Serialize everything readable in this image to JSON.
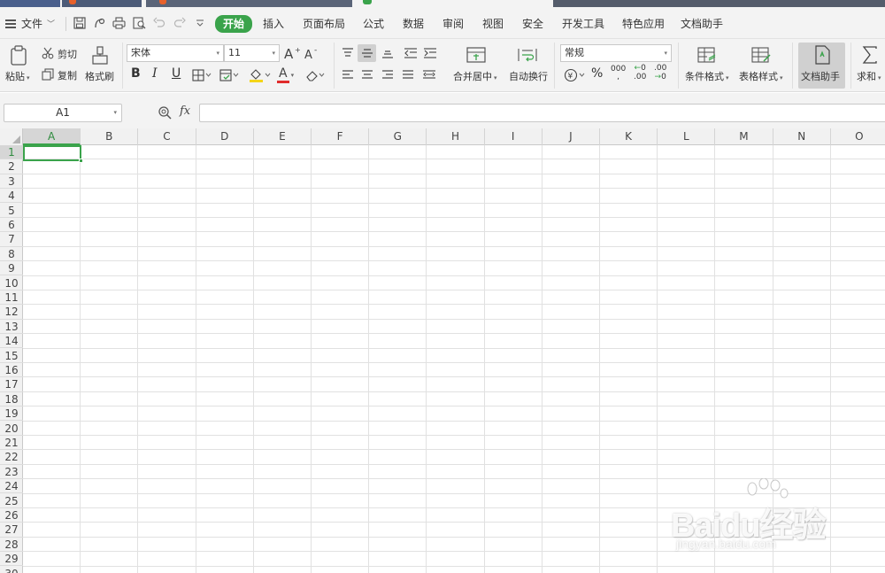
{
  "colors": {
    "accent": "#3aa34b",
    "ribbon_bg": "#f3f3f3",
    "grid_line": "#e1e1e1",
    "header_bg": "#f1f1f1"
  },
  "menu": {
    "file_label": "文件",
    "tabs": [
      {
        "label": "开始",
        "active": true
      },
      {
        "label": "插入"
      },
      {
        "label": "页面布局"
      },
      {
        "label": "公式"
      },
      {
        "label": "数据"
      },
      {
        "label": "审阅"
      },
      {
        "label": "视图"
      },
      {
        "label": "安全"
      },
      {
        "label": "开发工具"
      },
      {
        "label": "特色应用"
      },
      {
        "label": "文档助手"
      }
    ]
  },
  "ribbon": {
    "paste_label": "粘贴",
    "cut_label": "剪切",
    "copy_label": "复制",
    "format_painter_label": "格式刷",
    "font_name": "宋体",
    "font_size": "11",
    "bold_label": "B",
    "italic_label": "I",
    "underline_label": "U",
    "font_color_label": "A",
    "merge_center_label": "合并居中",
    "wrap_text_label": "自动换行",
    "number_format": "常规",
    "percent_label": "%",
    "thousands_label": "000",
    "inc_decimal_label": ".00",
    "dec_decimal_label": ".00",
    "conditional_format_label": "条件格式",
    "table_style_label": "表格样式",
    "doc_assistant_label": "文档助手",
    "sum_label": "求和"
  },
  "formula_bar": {
    "name_box": "A1",
    "fx_label": "fx",
    "formula_value": ""
  },
  "sheet": {
    "columns": [
      "A",
      "B",
      "C",
      "D",
      "E",
      "F",
      "G",
      "H",
      "I",
      "J",
      "K",
      "L",
      "M",
      "N",
      "O"
    ],
    "rows": [
      "1",
      "2",
      "3",
      "4",
      "5",
      "6",
      "7",
      "8",
      "9",
      "10",
      "11",
      "12",
      "13",
      "14",
      "15",
      "16",
      "17",
      "18",
      "19",
      "20",
      "21",
      "22",
      "23",
      "24",
      "25",
      "26",
      "27",
      "28",
      "29",
      "30"
    ],
    "active_cell": "A1"
  },
  "watermark": {
    "text": "Baidu经验",
    "sub": "jingyan.baidu.com"
  }
}
